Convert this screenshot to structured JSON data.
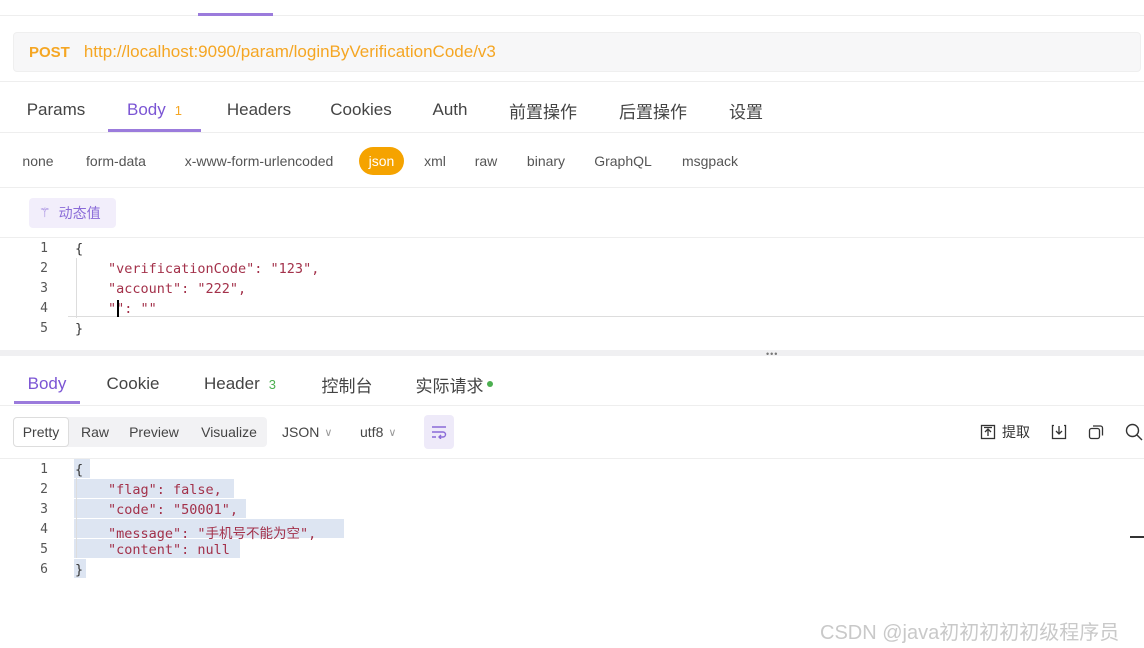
{
  "request": {
    "method": "POST",
    "url": "http://localhost:9090/param/loginByVerificationCode/v3"
  },
  "request_tabs": [
    {
      "label": "Params",
      "badge": "",
      "active": false
    },
    {
      "label": "Body",
      "badge": "1",
      "active": true
    },
    {
      "label": "Headers",
      "badge": "",
      "active": false
    },
    {
      "label": "Cookies",
      "badge": "",
      "active": false
    },
    {
      "label": "Auth",
      "badge": "",
      "active": false
    },
    {
      "label": "前置操作",
      "badge": "",
      "active": false
    },
    {
      "label": "后置操作",
      "badge": "",
      "active": false
    },
    {
      "label": "设置",
      "badge": "",
      "active": false
    }
  ],
  "body_types": [
    "none",
    "form-data",
    "x-www-form-urlencoded",
    "json",
    "xml",
    "raw",
    "binary",
    "GraphQL",
    "msgpack"
  ],
  "body_type_selected": "json",
  "dynamic_value_label": "动态值",
  "request_body": {
    "line_numbers": [
      "1",
      "2",
      "3",
      "4",
      "5"
    ],
    "lines": [
      "{",
      "\"verificationCode\": \"123\",",
      "\"account\": \"222\",",
      "\"\": \"\"",
      "}"
    ]
  },
  "response_tabs": [
    {
      "label": "Body",
      "badge": "",
      "active": true
    },
    {
      "label": "Cookie",
      "badge": "",
      "active": false
    },
    {
      "label": "Header",
      "badge": "3",
      "active": false
    },
    {
      "label": "控制台",
      "badge": "",
      "active": false
    },
    {
      "label": "实际请求",
      "badge": "",
      "active": false,
      "status_dot": "#4caf50"
    }
  ],
  "view_modes": [
    "Pretty",
    "Raw",
    "Preview",
    "Visualize"
  ],
  "view_mode_selected": "Pretty",
  "format_select": "JSON",
  "encoding_select": "utf8",
  "toolbar": {
    "extract_label": "提取"
  },
  "response_body": {
    "line_numbers": [
      "1",
      "2",
      "3",
      "4",
      "5",
      "6"
    ],
    "lines": [
      "{",
      "\"flag\": false,",
      "\"code\": \"50001\",",
      "\"message\": \"手机号不能为空\",",
      "\"content\": null",
      "}"
    ]
  },
  "watermark": "CSDN @java初初初初初级程序员",
  "colors": {
    "accent": "#7b55d4",
    "method": "#f5a623",
    "json_active": "#f5a300",
    "key": "#a3314a",
    "string": "#1d4fa8"
  }
}
